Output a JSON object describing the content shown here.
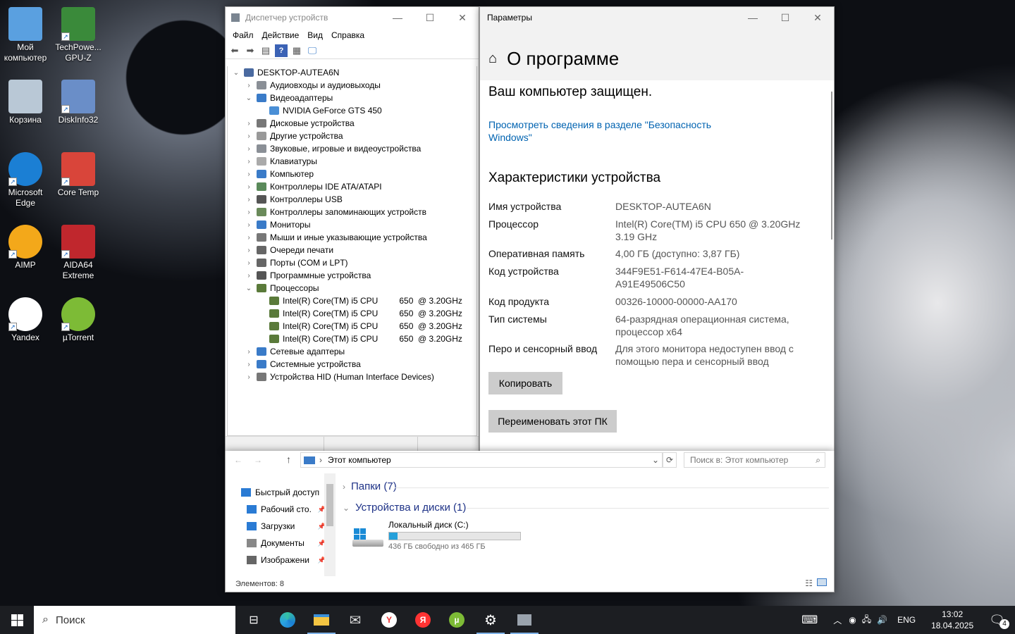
{
  "desktop": {
    "icons": [
      {
        "label": "Мой компьютер",
        "icon": "computer-icon"
      },
      {
        "label": "TechPowe... GPU-Z",
        "icon": "gpuz-icon"
      },
      {
        "label": "Корзина",
        "icon": "recycle-bin-icon"
      },
      {
        "label": "DiskInfo32",
        "icon": "diskinfo-icon"
      },
      {
        "label": "Microsoft Edge",
        "icon": "edge-icon"
      },
      {
        "label": "Core Temp",
        "icon": "coretemp-icon"
      },
      {
        "label": "AIMP",
        "icon": "aimp-icon"
      },
      {
        "label": "AIDA64 Extreme",
        "icon": "aida64-icon"
      },
      {
        "label": "Yandex",
        "icon": "yandex-icon"
      },
      {
        "label": "µTorrent",
        "icon": "utorrent-icon"
      }
    ]
  },
  "devmgr": {
    "title": "Диспетчер устройств",
    "menu": [
      "Файл",
      "Действие",
      "Вид",
      "Справка"
    ],
    "root": "DESKTOP-AUTEA6N",
    "nodes": [
      {
        "label": "Аудиовходы и аудиовыходы",
        "state": "collapsed",
        "color": "#8a8f96"
      },
      {
        "label": "Видеоадаптеры",
        "state": "expanded",
        "color": "#3a7bc8"
      },
      {
        "label": "NVIDIA GeForce GTS 450",
        "state": "child",
        "color": "#4a8fd6"
      },
      {
        "label": "Дисковые устройства",
        "state": "collapsed",
        "color": "#777"
      },
      {
        "label": "Другие устройства",
        "state": "collapsed",
        "color": "#999"
      },
      {
        "label": "Звуковые, игровые и видеоустройства",
        "state": "collapsed",
        "color": "#8a8f96"
      },
      {
        "label": "Клавиатуры",
        "state": "collapsed",
        "color": "#aaa"
      },
      {
        "label": "Компьютер",
        "state": "collapsed",
        "color": "#3a7bc8"
      },
      {
        "label": "Контроллеры IDE ATA/ATAPI",
        "state": "collapsed",
        "color": "#5a8a5a"
      },
      {
        "label": "Контроллеры USB",
        "state": "collapsed",
        "color": "#555"
      },
      {
        "label": "Контроллеры запоминающих устройств",
        "state": "collapsed",
        "color": "#6a8a5a"
      },
      {
        "label": "Мониторы",
        "state": "collapsed",
        "color": "#3a7bc8"
      },
      {
        "label": "Мыши и иные указывающие устройства",
        "state": "collapsed",
        "color": "#777"
      },
      {
        "label": "Очереди печати",
        "state": "collapsed",
        "color": "#666"
      },
      {
        "label": "Порты (COM и LPT)",
        "state": "collapsed",
        "color": "#666"
      },
      {
        "label": "Программные устройства",
        "state": "collapsed",
        "color": "#555"
      },
      {
        "label": "Процессоры",
        "state": "expanded",
        "color": "#5a7a3a"
      },
      {
        "label": "Intel(R) Core(TM) i5 CPU         650  @ 3.20GHz",
        "state": "child",
        "color": "#5a7a3a"
      },
      {
        "label": "Intel(R) Core(TM) i5 CPU         650  @ 3.20GHz",
        "state": "child",
        "color": "#5a7a3a"
      },
      {
        "label": "Intel(R) Core(TM) i5 CPU         650  @ 3.20GHz",
        "state": "child",
        "color": "#5a7a3a"
      },
      {
        "label": "Intel(R) Core(TM) i5 CPU         650  @ 3.20GHz",
        "state": "child",
        "color": "#5a7a3a"
      },
      {
        "label": "Сетевые адаптеры",
        "state": "collapsed",
        "color": "#3a7bc8"
      },
      {
        "label": "Системные устройства",
        "state": "collapsed",
        "color": "#3a7bc8"
      },
      {
        "label": "Устройства HID (Human Interface Devices)",
        "state": "collapsed",
        "color": "#777"
      }
    ]
  },
  "settings": {
    "title": "Параметры",
    "page_title": "О программе",
    "protected": "Ваш компьютер защищен.",
    "link": "Просмотреть сведения в разделе \"Безопасность Windows\"",
    "spec_header": "Характеристики устройства",
    "specs": [
      {
        "k": "Имя устройства",
        "v": "DESKTOP-AUTEA6N"
      },
      {
        "k": "Процессор",
        "v": "Intel(R) Core(TM) i5 CPU         650  @ 3.20GHz   3.19 GHz"
      },
      {
        "k": "Оперативная память",
        "v": "4,00 ГБ (доступно: 3,87 ГБ)"
      },
      {
        "k": "Код устройства",
        "v": "344F9E51-F614-47E4-B05A-A91E49506C50"
      },
      {
        "k": "Код продукта",
        "v": "00326-10000-00000-AA170"
      },
      {
        "k": "Тип системы",
        "v": "64-разрядная операционная система, процессор x64"
      },
      {
        "k": "Перо и сенсорный ввод",
        "v": "Для этого монитора недоступен ввод с помощью пера и сенсорный ввод"
      }
    ],
    "copy_btn": "Копировать",
    "rename_btn": "Переименовать этот ПК"
  },
  "explorer": {
    "address": "Этот компьютер",
    "search_placeholder": "Поиск в: Этот компьютер",
    "sidebar": [
      {
        "label": "Быстрый доступ",
        "icon": "star-icon"
      },
      {
        "label": "Рабочий сто.",
        "icon": "desktop-folder-icon"
      },
      {
        "label": "Загрузки",
        "icon": "download-icon"
      },
      {
        "label": "Документы",
        "icon": "documents-icon"
      },
      {
        "label": "Изображени",
        "icon": "pictures-icon"
      }
    ],
    "folders_group": "Папки (7)",
    "drives_group": "Устройства и диски (1)",
    "drive_name": "Локальный диск (C:)",
    "drive_free": "436 ГБ свободно из 465 ГБ",
    "drive_used_fraction": 0.062,
    "status": "Элементов: 8"
  },
  "taskbar": {
    "search": "Поиск",
    "lang": "ENG",
    "time": "13:02",
    "date": "18.04.2025",
    "notifications": "4"
  }
}
